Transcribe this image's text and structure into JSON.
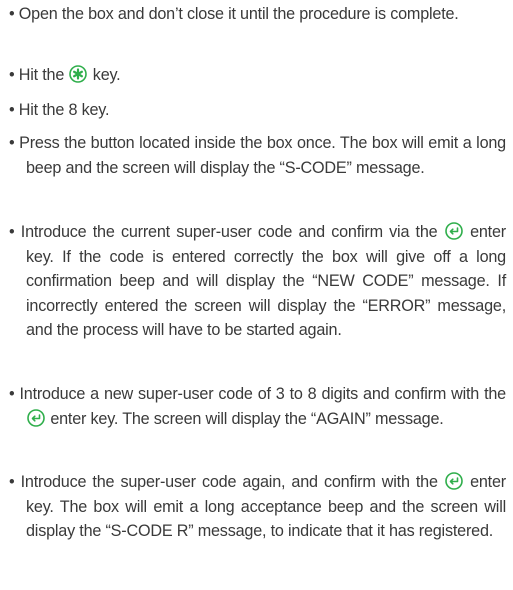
{
  "bullet_char": "•",
  "accent_color": "#2fae4b",
  "instructions": [
    {
      "text": "Open the box and don’t close it until the procedure is complete."
    },
    {
      "before": "Hit the",
      "icon": "asterisk-key-icon",
      "after": "key."
    },
    {
      "text": "Hit the 8 key."
    },
    {
      "text": "Press the button located inside the box once. The box will emit a long beep and the screen will display the “S-CODE” message."
    },
    {
      "before": "Introduce the current super-user code and confirm via the",
      "icon": "enter-key-icon",
      "after": "enter key. If the code is entered correctly the box will give off a long confirmation beep and will display the “NEW CODE” message. If incorrectly entered the screen will display the “ERROR” message, and the process will have to be started again."
    },
    {
      "before": "Introduce a new super-user code of 3 to 8 digits and confirm with the",
      "icon": "enter-key-icon",
      "after": "enter key. The screen will display the “AGAIN” message."
    },
    {
      "before": "Introduce the super-user code again, and confirm with the",
      "icon": "enter-key-icon",
      "after": "enter key. The box will emit a long acceptance beep and the screen will display the “S-CODE R” message, to indicate that it has registered."
    }
  ]
}
